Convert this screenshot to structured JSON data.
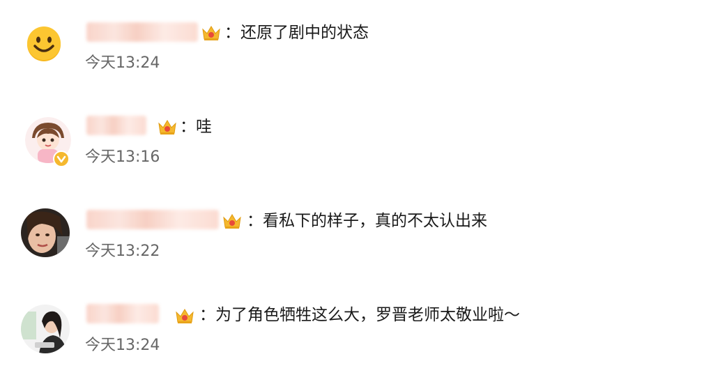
{
  "comments": [
    {
      "text": "：还原了剧中的状态",
      "time": "今天13:24",
      "avatar_icon": "smiley-avatar",
      "vip_icon": "crown-badge-icon"
    },
    {
      "text": "：哇",
      "time": "今天13:16",
      "avatar_icon": "cartoon-girl-avatar",
      "vip_icon": "crown-badge-icon",
      "verified_icon": "verified-v-icon"
    },
    {
      "text": "：看私下的样子，真的不太认出来",
      "time": "今天13:22",
      "avatar_icon": "photo-avatar",
      "vip_icon": "crown-badge-icon"
    },
    {
      "text": "：为了角色牺牲这么大，罗晋老师太敬业啦～",
      "time": "今天13:24",
      "avatar_icon": "photo-avatar",
      "vip_icon": "crown-badge-icon"
    }
  ],
  "colors": {
    "text": "#1a1a1a",
    "time": "#666666",
    "badge": "#f5b82e",
    "blur": "#f9d0c4"
  }
}
